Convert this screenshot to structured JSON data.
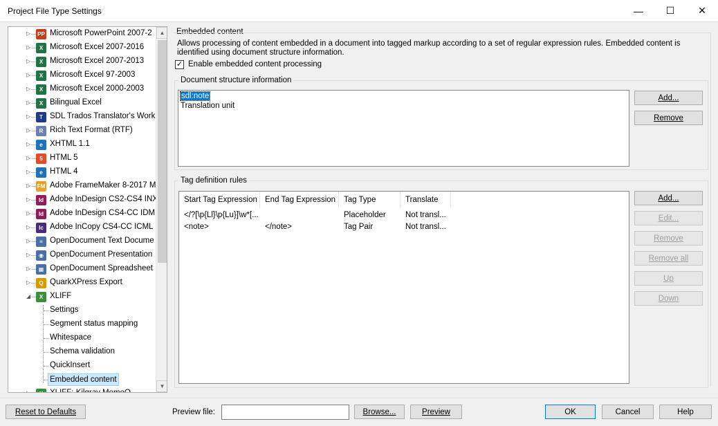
{
  "window": {
    "title": "Project File Type Settings",
    "minimize": "—",
    "maximize": "☐",
    "close": "✕"
  },
  "tree": {
    "items": [
      {
        "label": "Microsoft PowerPoint 2007-2",
        "icon": "PP",
        "color": "#c43e1c"
      },
      {
        "label": "Microsoft Excel 2007-2016",
        "icon": "X",
        "color": "#217346"
      },
      {
        "label": "Microsoft Excel 2007-2013",
        "icon": "X",
        "color": "#217346"
      },
      {
        "label": "Microsoft Excel 97-2003",
        "icon": "X",
        "color": "#217346"
      },
      {
        "label": "Microsoft Excel 2000-2003",
        "icon": "X",
        "color": "#217346"
      },
      {
        "label": "Bilingual Excel",
        "icon": "X",
        "color": "#217346"
      },
      {
        "label": "SDL Trados Translator's Work",
        "icon": "T",
        "color": "#1f3a8a"
      },
      {
        "label": "Rich Text Format (RTF)",
        "icon": "R",
        "color": "#6b7fb3"
      },
      {
        "label": "XHTML 1.1",
        "icon": "e",
        "color": "#1e73be"
      },
      {
        "label": "HTML 5",
        "icon": "5",
        "color": "#e44d26"
      },
      {
        "label": "HTML 4",
        "icon": "e",
        "color": "#1e73be"
      },
      {
        "label": "Adobe FrameMaker 8-2017 M",
        "icon": "FM",
        "color": "#e8a02a"
      },
      {
        "label": "Adobe InDesign CS2-CS4 INX",
        "icon": "Id",
        "color": "#8f1d56"
      },
      {
        "label": "Adobe InDesign CS4-CC IDML",
        "icon": "Id",
        "color": "#8f1d56"
      },
      {
        "label": "Adobe InCopy CS4-CC ICML",
        "icon": "Ic",
        "color": "#4b2a7a"
      },
      {
        "label": "OpenDocument Text Docume",
        "icon": "≡",
        "color": "#4a6fa5"
      },
      {
        "label": "OpenDocument Presentation",
        "icon": "◉",
        "color": "#4a6fa5"
      },
      {
        "label": "OpenDocument Spreadsheet",
        "icon": "▦",
        "color": "#4a6fa5"
      },
      {
        "label": "QuarkXPress Export",
        "icon": "Q",
        "color": "#d99a00"
      },
      {
        "label": "XLIFF",
        "icon": "X",
        "color": "#3a8f3a"
      }
    ],
    "children": [
      {
        "label": "Settings"
      },
      {
        "label": "Segment status mapping"
      },
      {
        "label": "Whitespace"
      },
      {
        "label": "Schema validation"
      },
      {
        "label": "QuickInsert"
      },
      {
        "label": "Embedded content"
      }
    ],
    "partial_item": "XLIFF: Kilgray MemoQ"
  },
  "embedded": {
    "group_title": "Embedded content",
    "description": "Allows processing of content embedded in a document into tagged markup according to a set of regular expression rules. Embedded content is identified using document structure information.",
    "enable_label": "Enable embedded content processing",
    "enable_checked": "✓"
  },
  "doc_structure": {
    "group_title": "Document structure information",
    "items": [
      "sdl:note",
      "Translation unit"
    ],
    "add_label": "Add...",
    "remove_label": "Remove"
  },
  "tag_rules": {
    "group_title": "Tag definition rules",
    "columns": [
      "Start Tag Expression",
      "End Tag Expression",
      "Tag Type",
      "Translate"
    ],
    "rows": [
      [
        "</?[\\p{Ll}\\p{Lu}]\\w*[...",
        "",
        "Placeholder",
        "Not transl..."
      ],
      [
        "<note>",
        "</note>",
        "Tag Pair",
        "Not transl..."
      ]
    ],
    "buttons": {
      "add": "Add...",
      "edit": "Edit...",
      "remove": "Remove",
      "remove_all": "Remove all",
      "up": "Up",
      "down": "Down"
    }
  },
  "bottom": {
    "reset_label": "Reset to Defaults",
    "preview_file_label": "Preview file:",
    "preview_file_value": "",
    "browse_label": "Browse...",
    "preview_label": "Preview",
    "ok_label": "OK",
    "cancel_label": "Cancel",
    "help_label": "Help"
  }
}
